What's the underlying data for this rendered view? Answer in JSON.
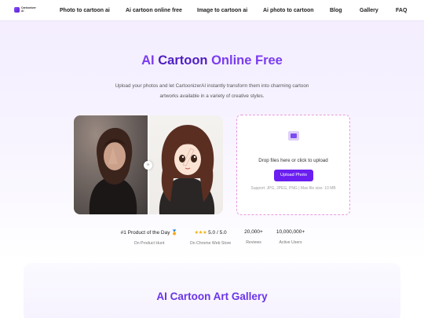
{
  "brand": {
    "logo_text": "Cartoonizer AI",
    "accent": "#6a1ef0",
    "title_color": "#7a3cf0"
  },
  "nav": {
    "items": [
      {
        "label": "Photo to cartoon ai"
      },
      {
        "label": "Ai cartoon online free"
      },
      {
        "label": "Image to cartoon ai"
      },
      {
        "label": "Ai photo to cartoon"
      },
      {
        "label": "Blog"
      },
      {
        "label": "Gallery"
      },
      {
        "label": "FAQ"
      }
    ]
  },
  "hero": {
    "title_part1": "AI",
    "title_part2": "Cartoon",
    "title_part3": "Online Free",
    "subtitle": "Upload your photos and let CartoonizerAI instantly transform them into charming cartoon artworks available in a variety of creative styles."
  },
  "compare": {
    "divider_icon": "‹›"
  },
  "upload": {
    "icon": "upload-icon",
    "drop_text": "Drop files here or click to upload",
    "button_label": "Upload Photo",
    "support_text": "Support: JPG, JPEG, PNG | Max file size: 10 MB"
  },
  "stats": [
    {
      "main": "#1 Product of the Day 🏅",
      "sub": "On Product Hunt"
    },
    {
      "stars": "★★★",
      "main": "5.0 / 5.0",
      "sub": "On Chrome Web Store"
    },
    {
      "main": "20,000+",
      "sub": "Reviews"
    },
    {
      "main": "10,000,000+",
      "sub": "Active Users"
    }
  ],
  "gallery": {
    "title": "AI Cartoon Art Gallery"
  }
}
